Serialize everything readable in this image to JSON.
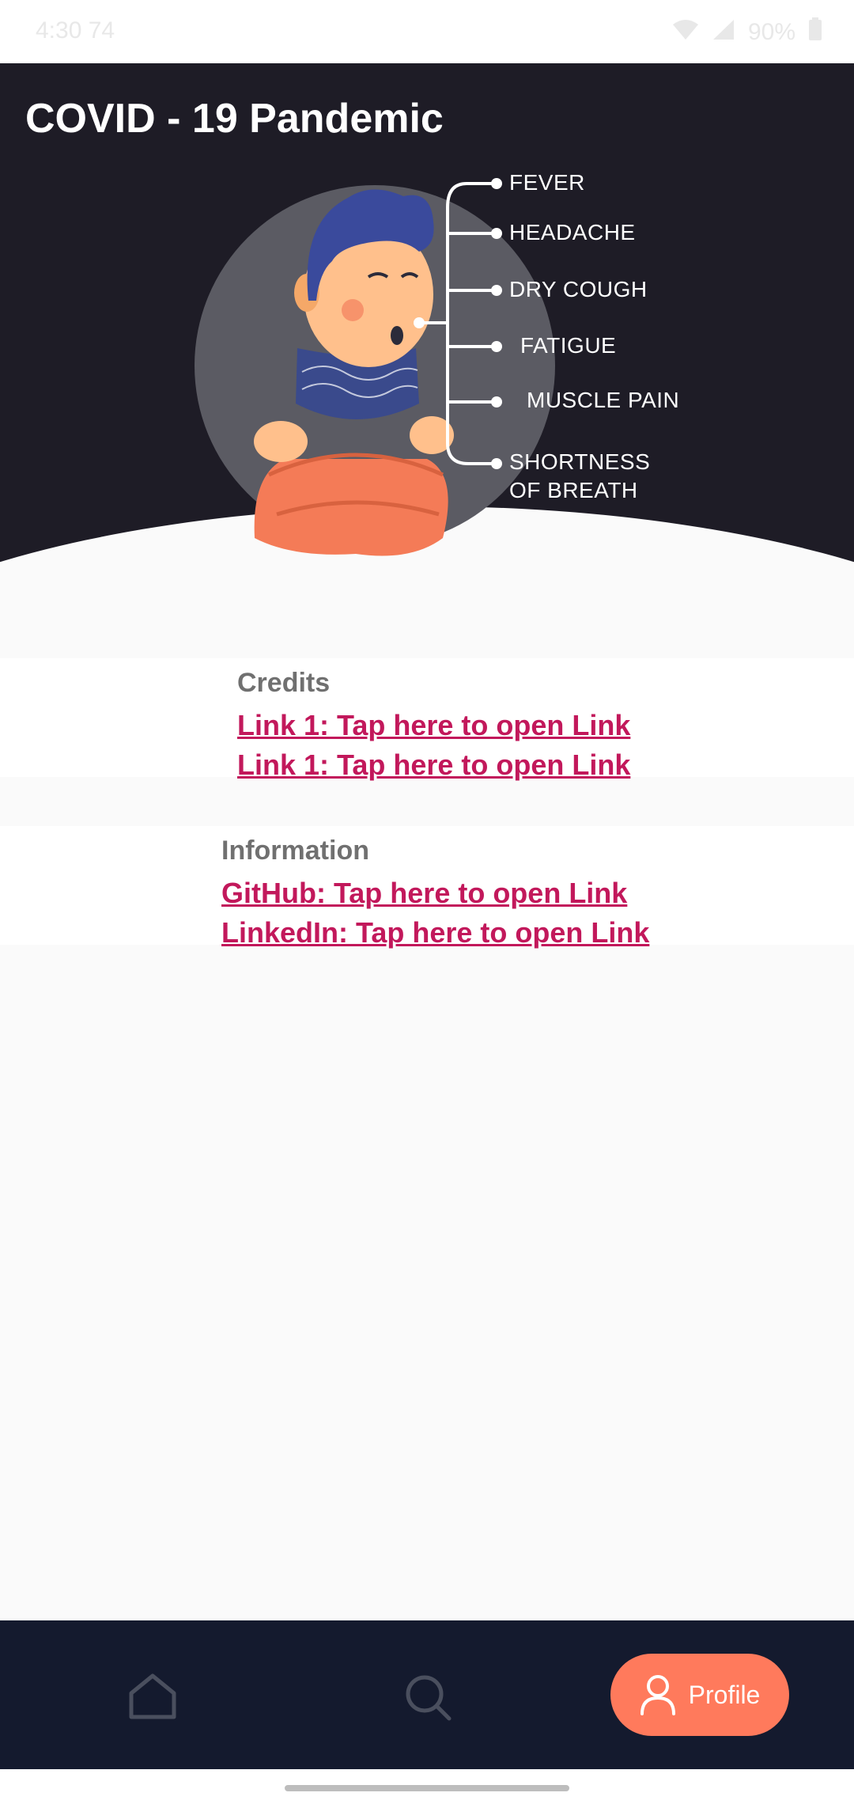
{
  "status_bar": {
    "time": "4:30 74",
    "battery": "90%"
  },
  "header": {
    "title": "COVID - 19 Pandemic",
    "symptoms": [
      "FEVER",
      "HEADACHE",
      "DRY COUGH",
      "FATIGUE",
      "MUSCLE PAIN",
      "SHORTNESS",
      "OF BREATH"
    ]
  },
  "credits": {
    "title": "Credits",
    "links": [
      "Link 1: Tap here to open Link",
      "Link 1: Tap here to open Link"
    ]
  },
  "information": {
    "title": "Information",
    "links": [
      "GitHub: Tap here to open Link",
      "LinkedIn: Tap here to open Link"
    ]
  },
  "bottom_nav": {
    "items": [
      {
        "icon": "home-icon"
      },
      {
        "icon": "search-icon"
      },
      {
        "icon": "person-icon",
        "label": "Profile",
        "active": true
      }
    ],
    "active_color": "#ff7a5c",
    "background": "#141a2e"
  },
  "colors": {
    "header_bg": "#1e1c26",
    "link": "#c2185b",
    "section_title": "#707070"
  }
}
